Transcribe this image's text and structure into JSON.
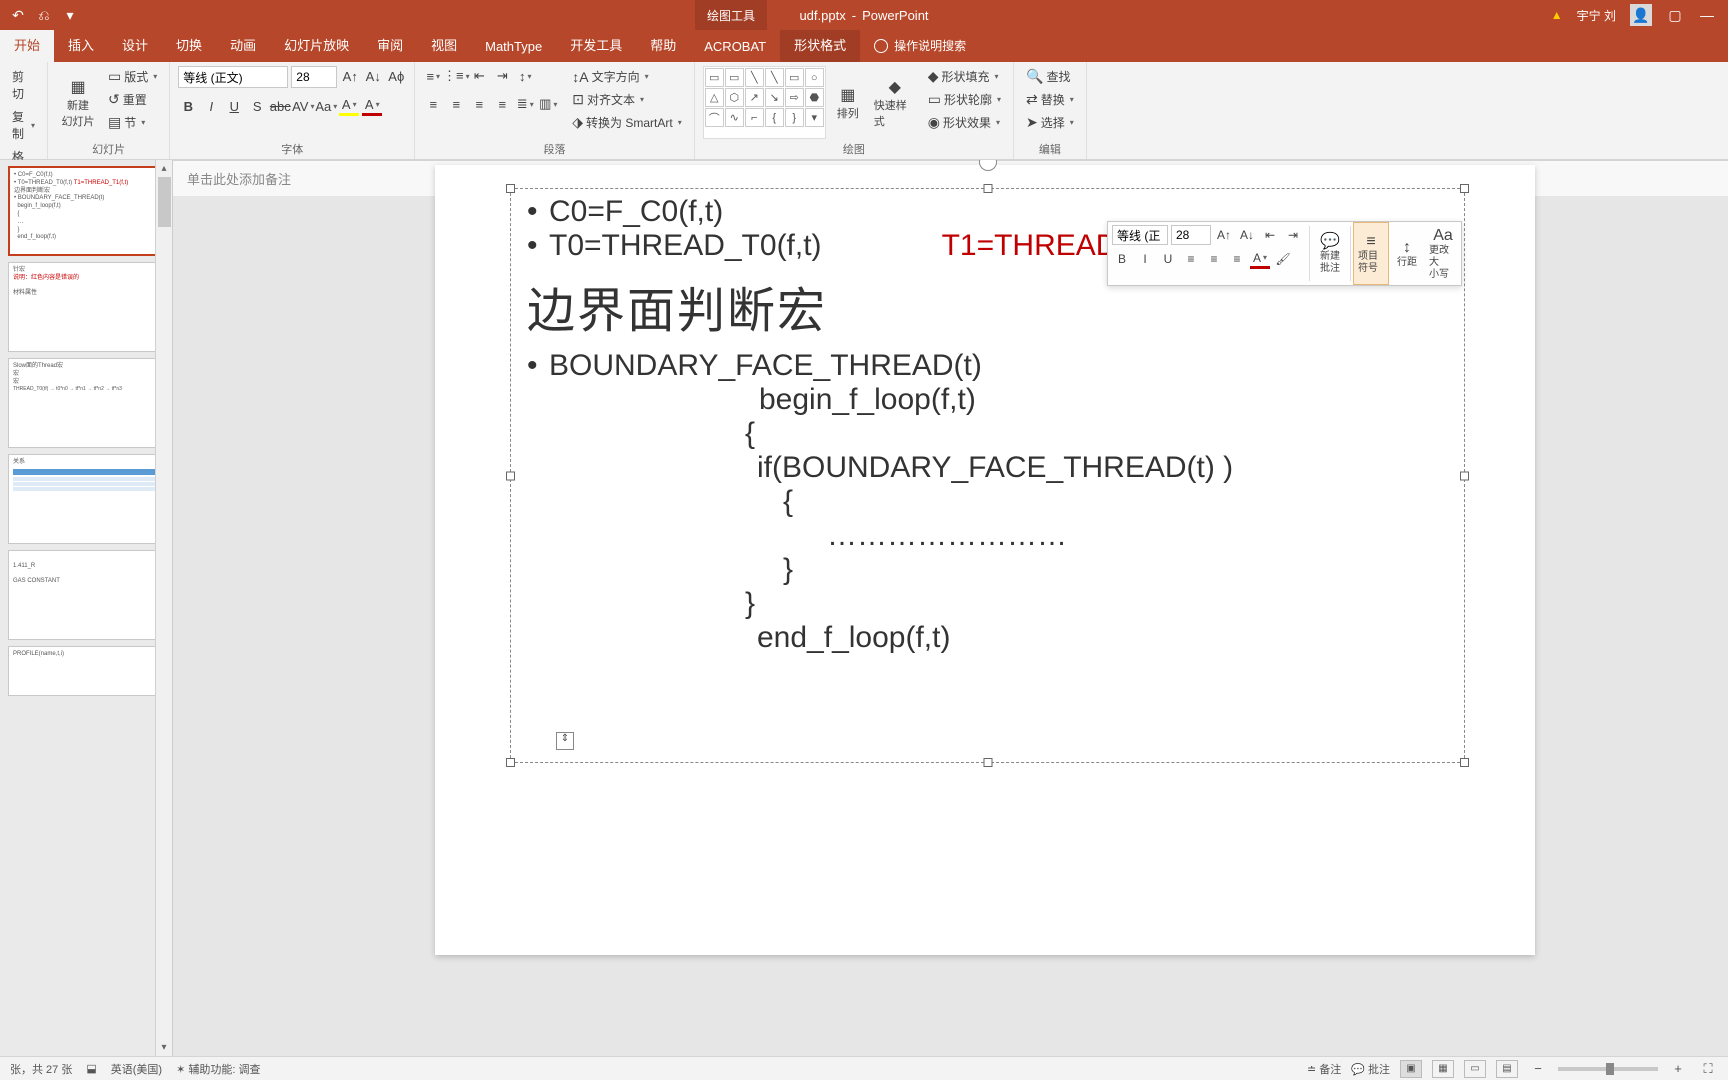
{
  "title": {
    "filename": "udf.pptx",
    "app": "PowerPoint",
    "context_tab": "绘图工具",
    "user": "宇宁 刘"
  },
  "tabs": [
    "开始",
    "插入",
    "设计",
    "切换",
    "动画",
    "幻灯片放映",
    "审阅",
    "视图",
    "MathType",
    "开发工具",
    "帮助",
    "ACROBAT",
    "形状格式"
  ],
  "tell_me": "操作说明搜索",
  "ribbon": {
    "clipboard": {
      "cut": "剪切",
      "copy": "复制",
      "painter": "格式刷"
    },
    "slides": {
      "new_slide": "新建\n幻灯片",
      "layout": "版式",
      "reset": "重置",
      "section": "节",
      "label": "幻灯片"
    },
    "font": {
      "name": "等线 (正文)",
      "size": "28",
      "label": "字体"
    },
    "paragraph": {
      "dir": "文字方向",
      "align": "对齐文本",
      "smart": "转换为 SmartArt",
      "label": "段落"
    },
    "drawing": {
      "arrange": "排列",
      "quick": "快速样式",
      "fill": "形状填充",
      "outline": "形状轮廓",
      "effects": "形状效果",
      "label": "绘图"
    },
    "editing": {
      "find": "查找",
      "replace": "替换",
      "select": "选择",
      "label": "编辑"
    }
  },
  "mini": {
    "font": "等线 (正",
    "size": "28",
    "new_comment": "新建\n批注",
    "bullets": "项目符号",
    "spacing": "行距",
    "case": "更改大\n小写"
  },
  "slide_content": {
    "l1": "C0=F_C0(f,t)",
    "l2a": "T0=THREAD_T0(f,t)",
    "l2b": "T1=THREAD_T1(f,t)",
    "heading": "边界面判断宏",
    "l3": "BOUNDARY_FACE_THREAD(t)",
    "l4": "begin_f_loop(f,t)",
    "l5": "{",
    "l6": "if(BOUNDARY_FACE_THREAD(t)   )",
    "l7": "{",
    "l8": "……………………",
    "l9": "}",
    "l10": "}",
    "l11": "end_f_loop(f,t)"
  },
  "notes_placeholder": "单击此处添加备注",
  "status": {
    "slide": "张，共 27 张",
    "lang": "英语(美国)",
    "access": "辅助功能: 调查",
    "notes": "备注",
    "comments": "批注"
  }
}
